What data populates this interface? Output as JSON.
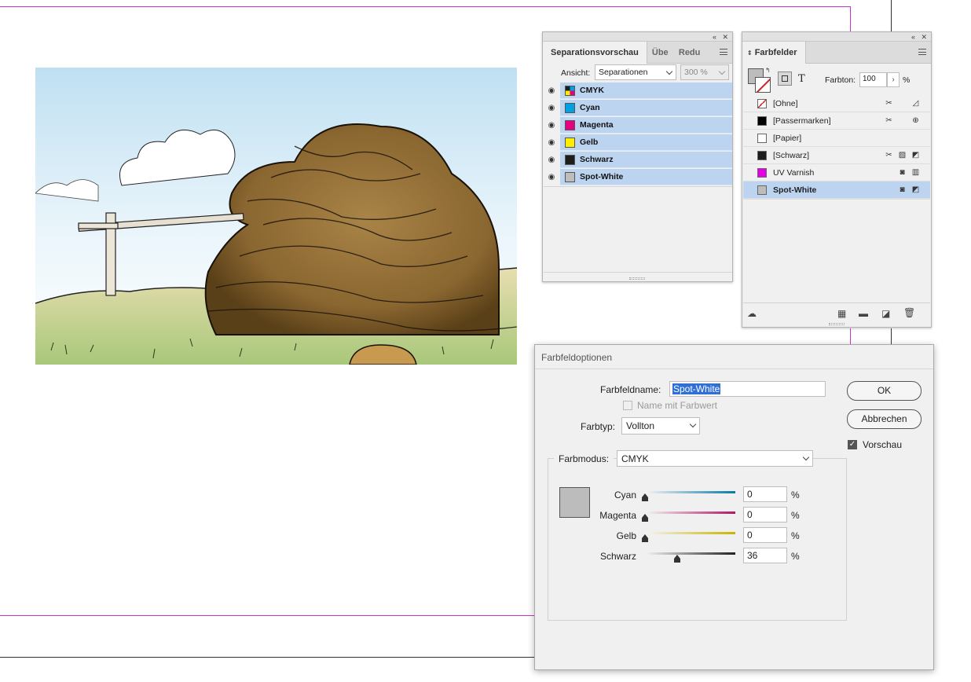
{
  "separations_panel": {
    "tabs": [
      "Separationsvorschau",
      "Übe",
      "Redu"
    ],
    "view_label": "Ansicht:",
    "view_value": "Separationen",
    "zoom_value": "300 %",
    "rows": [
      {
        "label": "CMYK",
        "color": "cmyk"
      },
      {
        "label": "Cyan",
        "color": "#00a0e3"
      },
      {
        "label": "Magenta",
        "color": "#e5007e"
      },
      {
        "label": "Gelb",
        "color": "#ffed00"
      },
      {
        "label": "Schwarz",
        "color": "#1d1d1b"
      },
      {
        "label": "Spot-White",
        "color": "#bdbdbd"
      }
    ]
  },
  "swatches_panel": {
    "tab": "Farbfelder",
    "tint_label": "Farbton:",
    "tint_value": "100",
    "tint_unit": "%",
    "rows": [
      {
        "label": "[Ohne]",
        "chip": "none",
        "selected": false
      },
      {
        "label": "[Passermarken]",
        "chip": "#000000",
        "selected": false
      },
      {
        "label": "[Papier]",
        "chip": "#ffffff",
        "selected": false
      },
      {
        "label": "[Schwarz]",
        "chip": "#1d1d1b",
        "selected": false
      },
      {
        "label": "UV Varnish",
        "chip": "#e600e6",
        "selected": false
      },
      {
        "label": "Spot-White",
        "chip": "#bdbdbd",
        "selected": true
      }
    ]
  },
  "dialog": {
    "title": "Farbfeldoptionen",
    "name_label": "Farbfeldname:",
    "name_value": "Spot-White",
    "name_with_value_label": "Name mit Farbwert",
    "type_label": "Farbtyp:",
    "type_value": "Vollton",
    "mode_label": "Farbmodus:",
    "mode_value": "CMYK",
    "ok_label": "OK",
    "cancel_label": "Abbrechen",
    "preview_label": "Vorschau",
    "preview_checked": true,
    "swatch_color": "#bcbcbc",
    "channels": [
      {
        "label": "Cyan",
        "value": "0",
        "unit": "%",
        "level": 0,
        "color": "#0a7aa8"
      },
      {
        "label": "Magenta",
        "value": "0",
        "unit": "%",
        "level": 0,
        "color": "#b0186a"
      },
      {
        "label": "Gelb",
        "value": "0",
        "unit": "%",
        "level": 0,
        "color": "#c8b400"
      },
      {
        "label": "Schwarz",
        "value": "36",
        "unit": "%",
        "level": 0.36,
        "color": "#222222"
      }
    ]
  }
}
